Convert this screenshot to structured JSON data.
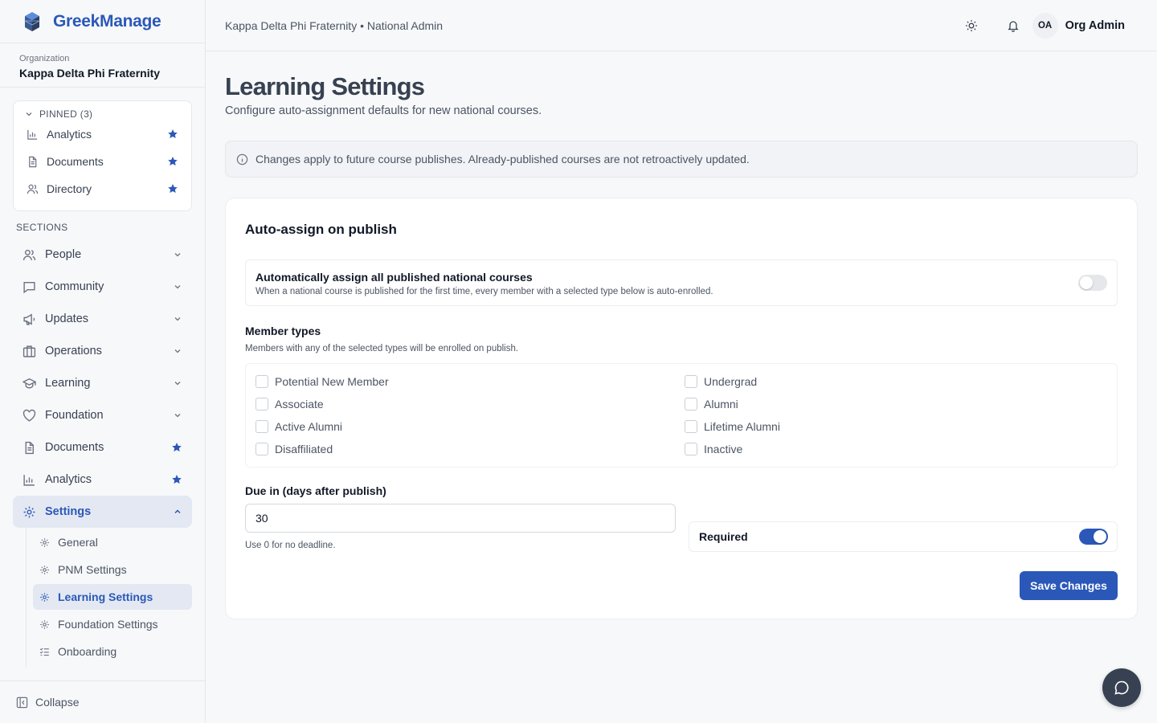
{
  "brand": {
    "name": "GreekManage"
  },
  "org": {
    "label": "Organization",
    "name": "Kappa Delta Phi Fraternity"
  },
  "pinned": {
    "title": "PINNED (3)",
    "items": [
      {
        "label": "Analytics",
        "icon": "bar-chart-icon"
      },
      {
        "label": "Documents",
        "icon": "document-icon"
      },
      {
        "label": "Directory",
        "icon": "users-icon"
      }
    ]
  },
  "sections": {
    "label": "SECTIONS",
    "items": [
      {
        "label": "People",
        "icon": "users-icon"
      },
      {
        "label": "Community",
        "icon": "message-icon"
      },
      {
        "label": "Updates",
        "icon": "megaphone-icon"
      },
      {
        "label": "Operations",
        "icon": "building-icon"
      },
      {
        "label": "Learning",
        "icon": "graduation-cap-icon"
      },
      {
        "label": "Foundation",
        "icon": "heart-icon"
      },
      {
        "label": "Documents",
        "icon": "document-icon"
      },
      {
        "label": "Analytics",
        "icon": "bar-chart-icon"
      },
      {
        "label": "Settings",
        "icon": "gear-icon"
      }
    ],
    "settings_sub": [
      {
        "label": "General"
      },
      {
        "label": "PNM Settings"
      },
      {
        "label": "Learning Settings"
      },
      {
        "label": "Foundation Settings"
      },
      {
        "label": "Onboarding"
      }
    ]
  },
  "collapse_label": "Collapse",
  "topbar": {
    "breadcrumb": "Kappa Delta Phi Fraternity • National Admin",
    "avatar_initials": "OA",
    "user_name": "Org Admin"
  },
  "page": {
    "title": "Learning Settings",
    "subtitle": "Configure auto-assignment defaults for new national courses.",
    "notice": "Changes apply to future course publishes. Already-published courses are not retroactively updated."
  },
  "card": {
    "title": "Auto-assign on publish",
    "auto_assign": {
      "title": "Automatically assign all published national courses",
      "description": "When a national course is published for the first time, every member with a selected type below is auto-enrolled.",
      "enabled": false
    },
    "member_types": {
      "title": "Member types",
      "description": "Members with any of the selected types will be enrolled on publish.",
      "options": [
        {
          "label": "Potential New Member",
          "checked": false
        },
        {
          "label": "Undergrad",
          "checked": false
        },
        {
          "label": "Associate",
          "checked": false
        },
        {
          "label": "Alumni",
          "checked": false
        },
        {
          "label": "Active Alumni",
          "checked": false
        },
        {
          "label": "Lifetime Alumni",
          "checked": false
        },
        {
          "label": "Disaffiliated",
          "checked": false
        },
        {
          "label": "Inactive",
          "checked": false
        }
      ]
    },
    "due": {
      "label": "Due in (days after publish)",
      "value": "30",
      "hint": "Use 0 for no deadline."
    },
    "required": {
      "label": "Required",
      "enabled": true
    },
    "save_label": "Save Changes"
  },
  "colors": {
    "accent": "#2b58b8",
    "chat": "#374151"
  }
}
